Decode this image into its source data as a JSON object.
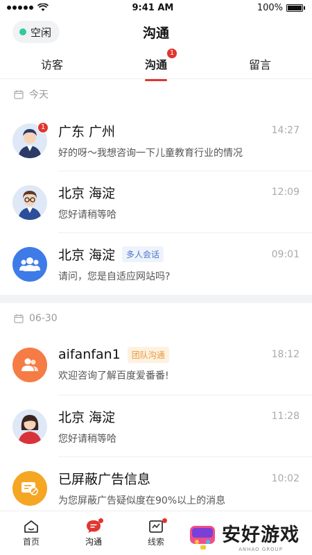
{
  "status_bar": {
    "time": "9:41 AM",
    "battery": "100%"
  },
  "header": {
    "status_label": "空闲",
    "title": "沟通",
    "status_color": "#2fcb9a"
  },
  "tabs": [
    {
      "label": "访客",
      "active": false
    },
    {
      "label": "沟通",
      "active": true,
      "badge": "1"
    },
    {
      "label": "留言",
      "active": false
    }
  ],
  "sections": [
    {
      "date": "今天",
      "items": [
        {
          "name": "广东 广州",
          "time": "14:27",
          "message": "好的呀～我想咨询一下儿童教育行业的情况",
          "badge": "1",
          "avatar": "man-icon"
        },
        {
          "name": "北京 海淀",
          "time": "12:09",
          "message": "您好请稍等哈",
          "avatar": "man-glasses-icon"
        },
        {
          "name": "北京 海淀",
          "tag": "多人会话",
          "time": "09:01",
          "message": "请问，您是自适应网站吗?",
          "avatar": "group-icon"
        }
      ]
    },
    {
      "date": "06-30",
      "items": [
        {
          "name": "aifanfan1",
          "tag": "团队沟通",
          "time": "18:12",
          "message": "欢迎咨询了解百度爱番番!",
          "avatar": "team-icon"
        },
        {
          "name": "北京 海淀",
          "time": "11:28",
          "message": "您好请稍等哈",
          "avatar": "woman-icon"
        },
        {
          "name": "已屏蔽广告信息",
          "time": "10:02",
          "message": "为您屏蔽广告疑似度在90%以上的消息",
          "avatar": "ad-block-icon"
        }
      ]
    }
  ],
  "bottom_nav": [
    {
      "label": "首页",
      "icon": "home-icon"
    },
    {
      "label": "沟通",
      "icon": "chat-icon",
      "active": true
    },
    {
      "label": "线索",
      "icon": "leads-icon"
    }
  ],
  "watermark": {
    "text": "安好游戏",
    "sub": "ANHAO GROUP"
  },
  "colors": {
    "accent": "#e1352f",
    "blue": "#3e7be8",
    "orange": "#f57c45",
    "yellow": "#f5a623"
  }
}
